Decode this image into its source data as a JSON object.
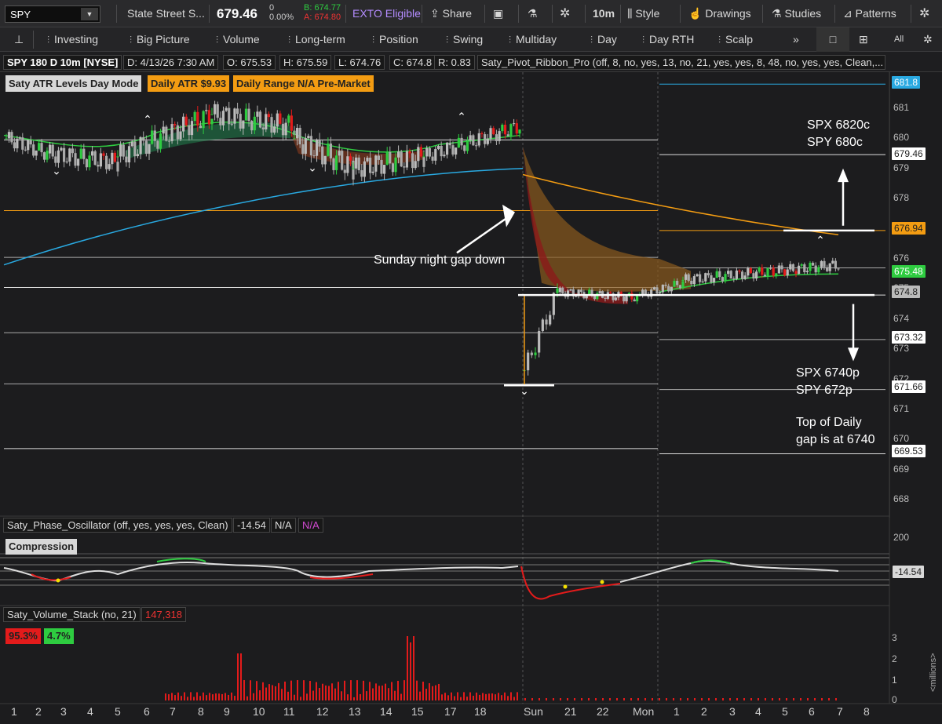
{
  "toolbar": {
    "symbol": "SPY",
    "company": "State Street S...",
    "last": "679.46",
    "change": "0",
    "change_pct": "0.00%",
    "bid": "B: 674.77",
    "ask": "A: 674.80",
    "exto": "EXTO Eligible",
    "share": "Share",
    "interval": "10m",
    "style": "Style",
    "drawings": "Drawings",
    "studies": "Studies",
    "patterns": "Patterns"
  },
  "presets": [
    "Investing",
    "Big Picture",
    "Volume",
    "Long-term",
    "Position",
    "Swing",
    "Multiday",
    "Day",
    "Day RTH",
    "Scalp"
  ],
  "presets_more": "»",
  "view_all": "All",
  "info": {
    "title": "SPY 180 D 10m [NYSE]",
    "date": "D: 4/13/26 7:30 AM",
    "open": "O: 675.53",
    "high": "H: 675.59",
    "low": "L: 674.76",
    "close": "C: 674.8",
    "range": "R: 0.83",
    "study": "Saty_Pivot_Ribbon_Pro (off, 8, no, yes, 13, no, 21, yes, yes, 8, 48, no, yes, yes, Clean,..."
  },
  "badges": {
    "atr_mode": "Saty ATR Levels Day Mode",
    "daily_atr": "Daily ATR $9.93",
    "daily_range": "Daily Range N/A Pre-Market"
  },
  "annotations": {
    "gap": "Sunday night gap down",
    "calls_1": "SPX 6820c",
    "calls_2": "SPY 680c",
    "puts_1": "SPX 6740p",
    "puts_2": "SPY 672p",
    "gap_note_1": "Top of Daily",
    "gap_note_2": "gap is at 6740"
  },
  "price_ticks": [
    "681",
    "680",
    "679",
    "678",
    "677",
    "676",
    "675",
    "674",
    "673",
    "672",
    "671",
    "670",
    "669",
    "668"
  ],
  "price_labels": {
    "p1": "681.8",
    "p2": "679.46",
    "p3": "676.94",
    "p4": "675.48",
    "p5": "674.8",
    "p6": "673.32",
    "p7": "671.66",
    "p8": "669.53"
  },
  "osc": {
    "title": "Saty_Phase_Oscillator (off, yes, yes, yes, Clean)",
    "value": "-14.54",
    "na1": "N/A",
    "na2": "N/A",
    "compression": "Compression",
    "axis_top": "200",
    "label": "-14.54"
  },
  "volume": {
    "title": "Saty_Volume_Stack (no, 21)",
    "total": "147,318",
    "red_pct": "95.3%",
    "green_pct": "4.7%",
    "ticks": [
      "3",
      "2",
      "1",
      "0"
    ],
    "unit": "<millions>"
  },
  "x_labels": [
    "1",
    "2",
    "3",
    "4",
    "5",
    "6",
    "7",
    "8",
    "9",
    "10",
    "11",
    "12",
    "13",
    "14",
    "15",
    "17",
    "18",
    "Sun",
    "21",
    "22",
    "Mon",
    "1",
    "2",
    "3",
    "4",
    "5",
    "6",
    "7",
    "8"
  ],
  "colors": {
    "bg": "#1c1c1e",
    "up": "#2ecc40",
    "down": "#e31b1b",
    "orange": "#f39c12",
    "blue": "#29a9e1",
    "grey": "#bbbbbb"
  },
  "chart_data": {
    "type": "candlestick",
    "symbol": "SPY",
    "interval": "10m",
    "ylim": [
      667.5,
      682.5
    ],
    "levels": [
      681.8,
      679.46,
      676.94,
      675.48,
      674.8,
      673.32,
      671.66,
      669.53
    ],
    "last_close": 674.8,
    "gap_low": 671.8
  }
}
